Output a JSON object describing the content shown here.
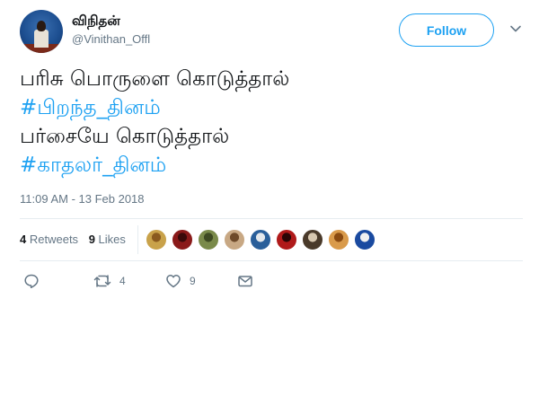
{
  "tweet": {
    "author_name": "விநிதன்",
    "author_handle": "@Vinithan_Offl",
    "follow_label": "Follow",
    "lines": [
      {
        "text": "பரிசு பொருளை கொடுத்தால்",
        "hashtag": false
      },
      {
        "text": "#பிறந்த_தினம்",
        "hashtag": true
      },
      {
        "text": "பர்சையே கொடுத்தால்",
        "hashtag": false
      },
      {
        "text": "#காதலர்_தினம்",
        "hashtag": true
      }
    ],
    "timestamp": "11:09 AM - 13 Feb 2018"
  },
  "stats": {
    "retweets_count": "4",
    "retweets_label": "Retweets",
    "likes_count": "9",
    "likes_label": "Likes"
  },
  "likers": [
    {
      "color": "#c9a24a",
      "accent": "#8a5a1e"
    },
    {
      "color": "#8a1a1a",
      "accent": "#3a0a0a"
    },
    {
      "color": "#7a8a4a",
      "accent": "#3e4a22"
    },
    {
      "color": "#c8a884",
      "accent": "#6e4a2a"
    },
    {
      "color": "#2a5f9a",
      "accent": "#e4e8ec"
    },
    {
      "color": "#b01a1a",
      "accent": "#2a0505"
    },
    {
      "color": "#4a3a2a",
      "accent": "#d8c8b0"
    },
    {
      "color": "#d99a4a",
      "accent": "#8a4a10"
    },
    {
      "color": "#1a4aa0",
      "accent": "#f0f0f0"
    }
  ],
  "actions": {
    "reply_icon": "reply-icon",
    "retweet_icon": "retweet-icon",
    "retweet_count": "4",
    "like_icon": "heart-icon",
    "like_count": "9",
    "dm_icon": "envelope-icon"
  },
  "colors": {
    "accent": "#1da1f2",
    "secondary_text": "#657786",
    "primary_text": "#14171a",
    "divider": "#e6ecf0"
  }
}
